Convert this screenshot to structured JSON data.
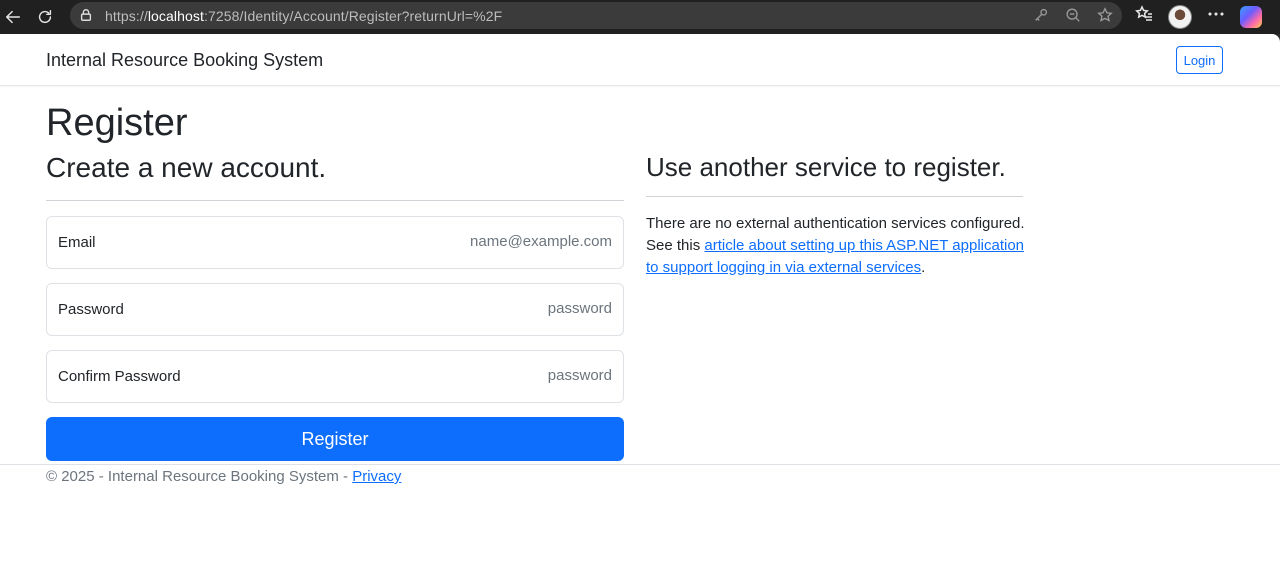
{
  "browser": {
    "url_scheme": "https://",
    "url_host": "localhost",
    "url_rest": ":7258/Identity/Account/Register?returnUrl=%2F"
  },
  "navbar": {
    "brand": "Internal Resource Booking System",
    "login_label": "Login"
  },
  "main": {
    "title": "Register",
    "subtitle": "Create a new account.",
    "fields": {
      "email": {
        "label": "Email",
        "placeholder": "name@example.com"
      },
      "password": {
        "label": "Password",
        "placeholder": "password"
      },
      "confirm": {
        "label": "Confirm Password",
        "placeholder": "password"
      }
    },
    "register_label": "Register"
  },
  "external": {
    "heading": "Use another service to register.",
    "line1": "There are no external authentication services configured.",
    "see_this": "See this ",
    "link_text": "article about setting up this ASP.NET application to support logging in via external services",
    "period": "."
  },
  "footer": {
    "text": "© 2025 - Internal Resource Booking System - ",
    "privacy_label": "Privacy"
  },
  "colors": {
    "primary": "#0d6efd",
    "text": "#212529",
    "muted": "#6c757d"
  }
}
